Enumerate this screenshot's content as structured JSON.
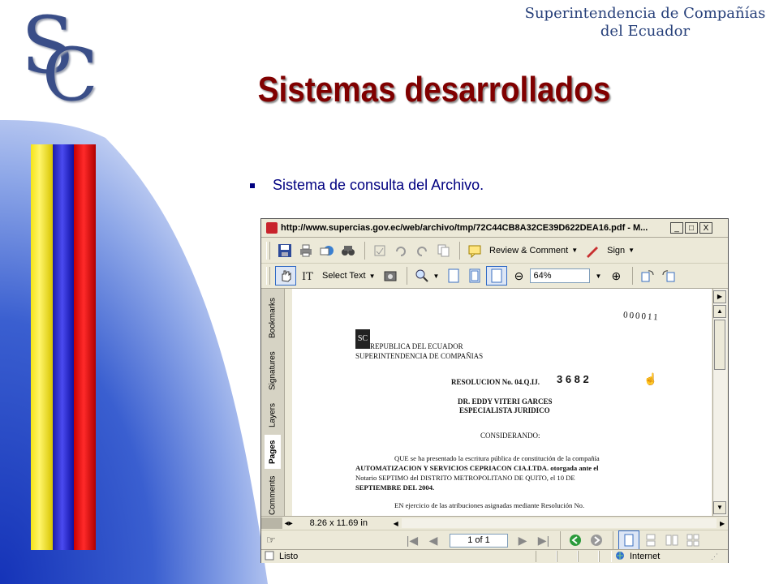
{
  "slide": {
    "org_name_line1": "Superintendencia de Compañías",
    "org_name_line2": "del Ecuador",
    "logo_letter_s": "S",
    "logo_letter_c": "C",
    "title": "Sistemas desarrollados",
    "bullet": "Sistema de consulta del Archivo."
  },
  "window": {
    "title": "http://www.supercias.gov.ec/web/archivo/tmp/72C44CB8A32CE39D622DEA16.pdf - M...",
    "minimize": "_",
    "maximize": "□",
    "close": "X"
  },
  "toolbar1": {
    "review_label": "Review & Comment",
    "sign_label": "Sign"
  },
  "toolbar2": {
    "select_text_label": "Select Text",
    "zoom_value": "64%",
    "zoom_out": "⊖",
    "zoom_in": "⊕"
  },
  "side_tabs": [
    "Bookmarks",
    "Signatures",
    "Layers",
    "Pages",
    "Comments"
  ],
  "page_size": "8.26 x 11.69 in",
  "navigation": {
    "page_indicator": "1 of 1"
  },
  "status": {
    "left": "Listo",
    "zone": "Internet"
  },
  "document": {
    "stamp_number": "000011",
    "header_line1": "REPUBLICA DEL ECUADOR",
    "header_line2": "SUPERINTENDENCIA DE COMPAÑIAS",
    "resolution_label": "RESOLUCION No. 04.Q.IJ.",
    "resolution_number": "3 6 8 2",
    "signer_name": "DR. EDDY VITERI GARCES",
    "signer_title": "ESPECIALISTA JURIDICO",
    "considerando": "CONSIDERANDO:",
    "para1_line1": "QUE se ha presentado la escritura pública de constitución de la compañía",
    "para1_line2": "AUTOMATIZACION Y SERVICIOS CEPRIACON CIA.LTDA. otorgada ante el",
    "para1_line3": "Notario SEPTIMO del DISTRITO METROPOLITANO DE QUITO, el 10 DE",
    "para1_line4": "SEPTIEMBRE DEL 2004.",
    "para2_line1": "EN ejercicio de las atribuciones asignadas mediante Resolución No."
  },
  "colors": {
    "title": "#800000",
    "bullet": "#000080",
    "org": "#27407a",
    "stripe_yellow": "#f6e418",
    "stripe_blue": "#1c1ca8",
    "stripe_red": "#c80000"
  }
}
